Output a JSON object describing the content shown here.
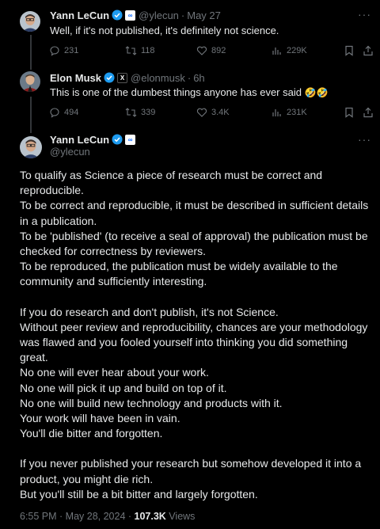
{
  "tweet1": {
    "name": "Yann LeCun",
    "handle": "@ylecun",
    "time": "May 27",
    "text": "Well, if it's not published, it's definitely not science.",
    "stats": {
      "replies": "231",
      "retweets": "118",
      "likes": "892",
      "views": "229K"
    }
  },
  "tweet2": {
    "name": "Elon Musk",
    "affiliate_badge": "X",
    "handle": "@elonmusk",
    "time": "6h",
    "text": "This is one of the dumbest things anyone has ever said",
    "emoji": "🤣🤣",
    "stats": {
      "replies": "494",
      "retweets": "339",
      "likes": "3.4K",
      "views": "231K"
    }
  },
  "main": {
    "name": "Yann LeCun",
    "handle": "@ylecun",
    "lines": [
      "To qualify as Science a piece of research must be correct and",
      "reproducible.",
      "To be correct and reproducible, it must be described in sufficient details",
      "in a publication.",
      "To be 'published' (to receive a seal of approval) the publication must be",
      "checked for correctness by reviewers.",
      "To be reproduced, the publication must be widely available to the",
      "community and sufficiently interesting.",
      "",
      "If you do research and don't publish, it's not Science.",
      "Without peer review and reproducibility, chances are your methodology",
      "was flawed and you fooled yourself into thinking you did something",
      "great.",
      "No one will ever hear about your work.",
      "No one will pick it up and build on top of it.",
      "No one will build new technology and products with it.",
      "Your work will have been in vain.",
      "You'll die bitter and forgotten.",
      "",
      "If you never published your research but somehow developed it into a",
      "product, you might die rich.",
      "But you'll still be a bit bitter and largely forgotten."
    ],
    "footer": {
      "timestamp": "6:55 PM · May 28, 2024 · ",
      "views_count": "107.3K",
      "views_label": " Views"
    }
  },
  "colors": {
    "background": "#000000",
    "text": "#e7e9ea",
    "muted": "#71767b",
    "verified_blue": "#1d9bf0"
  }
}
